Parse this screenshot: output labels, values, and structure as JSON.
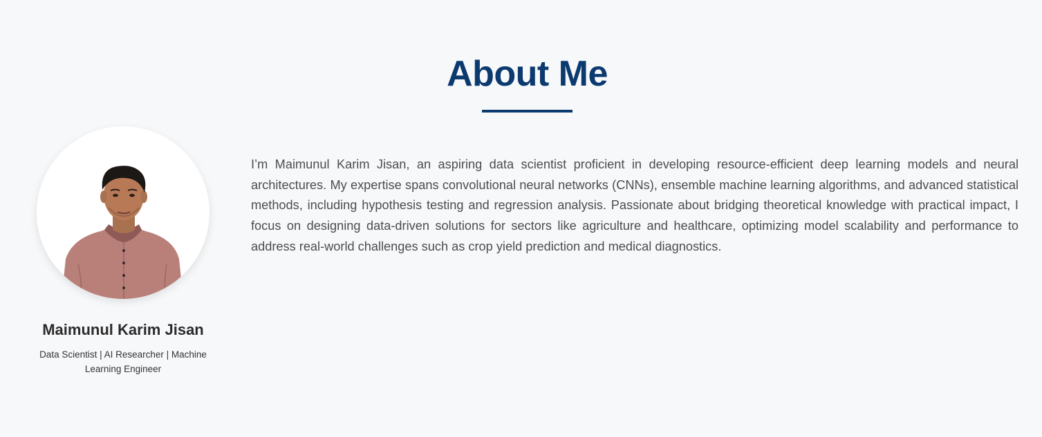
{
  "section": {
    "title": "About Me"
  },
  "profile": {
    "name": "Maimunul Karim Jisan",
    "role": "Data Scientist | AI Researcher | Machine Learning Engineer"
  },
  "bio": {
    "text": "I’m Maimunul Karim Jisan, an aspiring data scientist proficient in developing resource-efficient deep learning models and neural architectures. My expertise spans convolutional neural networks (CNNs), ensemble machine learning algorithms, and advanced statistical methods, including hypothesis testing and regression analysis. Passionate about bridging theoretical knowledge with practical impact, I focus on designing data-driven solutions for sectors like agriculture and healthcare, optimizing model scalability and performance to address real-world challenges such as crop yield prediction and medical diagnostics."
  },
  "colors": {
    "background": "#f7f8fa",
    "accent": "#0b3a6f",
    "heading_text": "#2b2b2b",
    "body_text": "#4d4d4d"
  },
  "icons": {
    "profile_photo": "person-portrait"
  }
}
